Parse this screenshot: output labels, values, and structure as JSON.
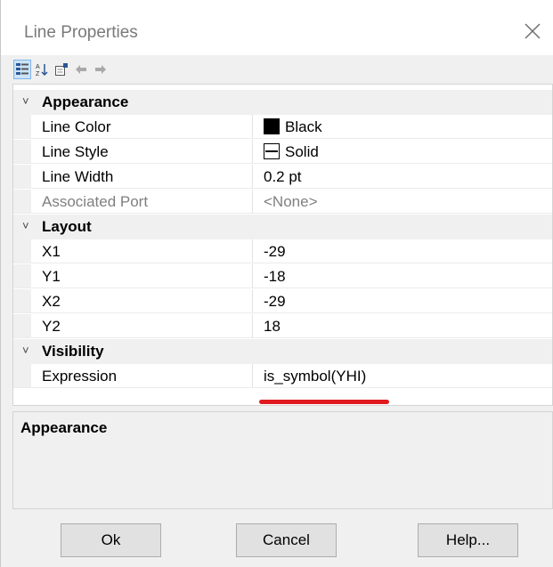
{
  "window": {
    "title": "Line Properties"
  },
  "toolbar": {
    "buttons": [
      {
        "name": "categorized-icon",
        "active": true
      },
      {
        "name": "alphabetical-icon",
        "active": false
      },
      {
        "name": "property-pages-icon",
        "active": false
      },
      {
        "name": "back-icon",
        "active": false
      },
      {
        "name": "forward-icon",
        "active": false
      }
    ]
  },
  "grid": {
    "categories": [
      {
        "label": "Appearance",
        "chevron": "˅"
      },
      {
        "label": "Layout",
        "chevron": "˅"
      },
      {
        "label": "Visibility",
        "chevron": "˅"
      }
    ],
    "appearance": {
      "line_color": {
        "name": "Line Color",
        "value": "Black"
      },
      "line_style": {
        "name": "Line Style",
        "value": "Solid"
      },
      "line_width": {
        "name": "Line Width",
        "value": "0.2 pt"
      },
      "associated_port": {
        "name": "Associated Port",
        "value": "<None>"
      }
    },
    "layout": {
      "x1": {
        "name": "X1",
        "value": "-29"
      },
      "y1": {
        "name": "Y1",
        "value": "-18"
      },
      "x2": {
        "name": "X2",
        "value": "-29"
      },
      "y2": {
        "name": "Y2",
        "value": "18"
      }
    },
    "visibility": {
      "expression": {
        "name": "Expression",
        "value": "is_symbol(YHI)"
      }
    }
  },
  "description": {
    "title": "Appearance"
  },
  "buttons": {
    "ok": "Ok",
    "cancel": "Cancel",
    "help": "Help..."
  },
  "colors": {
    "highlight_underline": "#e0191f",
    "toolbar_active": "#cce4f7"
  }
}
